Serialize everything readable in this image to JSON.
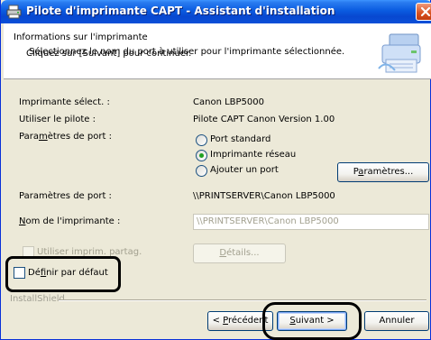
{
  "window": {
    "title": "Pilote d'imprimante CAPT - Assistant d'installation",
    "accent": "#0a5be0"
  },
  "header": {
    "title": "Informations sur l'imprimante",
    "subtitle": "Sélectionnez le nom du port à utiliser pour l'imprimante sélectionnée.",
    "hint": "Cliquez sur [Suivant] pour continuer."
  },
  "fields": {
    "printer_label": "Imprimante sélect. :",
    "printer_value": "Canon LBP5000",
    "driver_label": "Utiliser le pilote :",
    "driver_value": "Pilote CAPT Canon Version 1.00",
    "port_settings_label": {
      "pre": "Para",
      "key": "m",
      "post": "ètres de port :"
    },
    "port_options": [
      "Port standard",
      "Imprimante réseau",
      "Ajouter un port"
    ],
    "port_selected": "Imprimante réseau",
    "port_path_label": "Paramètres de port :",
    "port_path_value": "\\\\PRINTSERVER\\Canon LBP5000",
    "printer_name_label": {
      "key": "N",
      "post": "om de l'imprimante :"
    },
    "printer_name_value": "\\\\PRINTSERVER\\Canon LBP5000"
  },
  "buttons": {
    "params": {
      "pre": "P",
      "key": "a",
      "post": "ramètres..."
    },
    "details": {
      "key": "D",
      "post": "étails..."
    },
    "prev": {
      "pre": "< ",
      "key": "P",
      "post": "récédent"
    },
    "next": {
      "key": "S",
      "post": "uivant >"
    },
    "cancel": "Annuler"
  },
  "checkboxes": {
    "share": "Utiliser imprim. partag.",
    "default": {
      "pre": "Dé",
      "key": "f",
      "post": "inir par défaut"
    }
  },
  "footer": {
    "brand": "InstallShield"
  }
}
